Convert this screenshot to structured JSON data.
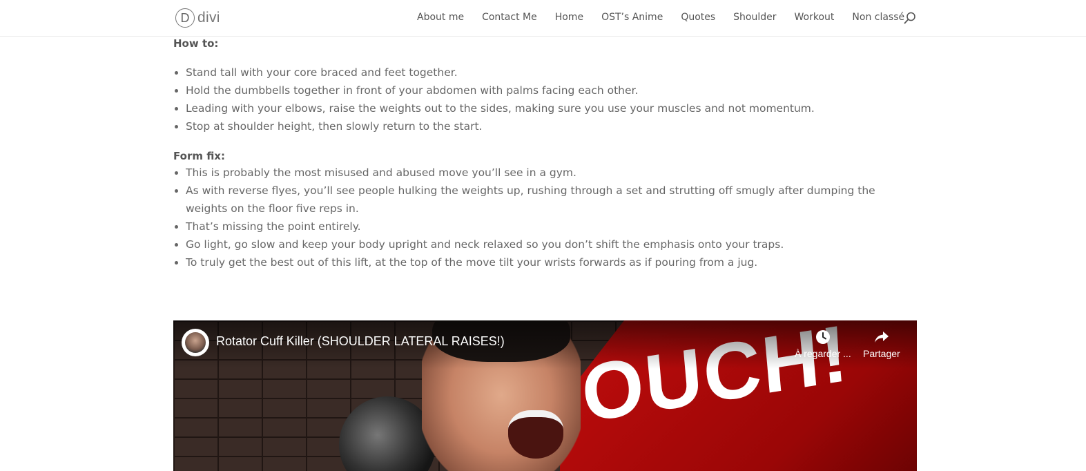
{
  "header": {
    "logo_mark": "D",
    "logo_text": "divi",
    "nav": [
      "About me",
      "Contact Me",
      "Home",
      "OST’s Anime",
      "Quotes",
      "Shoulder",
      "Workout",
      "Non classé"
    ],
    "search_icon": "search-icon"
  },
  "sections": {
    "how_to": {
      "heading": "How to:",
      "items": [
        "Stand tall with your core braced and feet together.",
        "Hold the dumbbells together in front of your abdomen with palms facing each other.",
        "Leading with your elbows, raise the weights out to the sides, making sure you use your muscles and not momentum.",
        "Stop at shoulder height, then slowly return to the start."
      ]
    },
    "form_fix": {
      "heading": "Form fix:",
      "items": [
        "This is probably the most misused and abused move you’ll see in a gym.",
        "As with reverse flyes, you’ll see people hulking the weights up, rushing through a set and strutting off smugly after dumping the weights on the floor five reps in.",
        "That’s missing the point entirely.",
        "Go light, go slow and keep your body upright and neck relaxed so you don’t shift the emphasis onto your traps.",
        "To truly get the best out of this lift, at the top of the move tilt your wrists forwards as if pouring from a jug."
      ]
    }
  },
  "video": {
    "title": "Rotator Cuff Killer (SHOULDER LATERAL RAISES!)",
    "watch_later_label": "À regarder ...",
    "share_label": "Partager",
    "thumbnail_text": "OUCH!",
    "accent_color": "#c10d0d"
  }
}
